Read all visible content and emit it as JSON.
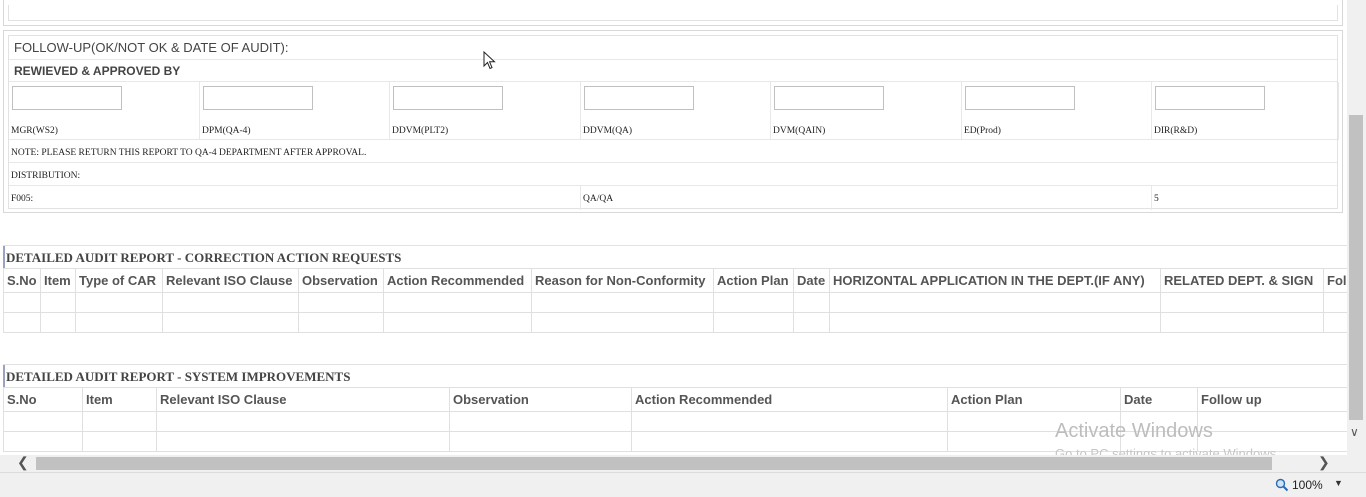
{
  "followup": {
    "title": "FOLLOW-UP(OK/NOT OK & DATE OF AUDIT):",
    "reviewed_title": "REWIEVED & APPROVED BY",
    "signatures": [
      "MGR(WS2)",
      "DPM(QA-4)",
      "DDVM(PLT2)",
      "DDVM(QA)",
      "DVM(QAIN)",
      "ED(Prod)",
      "DIR(R&D)"
    ],
    "note": "NOTE: PLEASE RETURN THIS REPORT TO QA-4 DEPARTMENT AFTER APPROVAL.",
    "distribution": "DISTRIBUTION:",
    "footer": {
      "form_no": "F005:",
      "dept": "QA/QA",
      "count": "5"
    }
  },
  "car_section": {
    "title": "DETAILED AUDIT REPORT - CORRECTION ACTION REQUESTS",
    "columns": [
      "S.No",
      "Item",
      "Type of CAR",
      "Relevant ISO Clause",
      "Observation",
      "Action Recommended",
      "Reason for Non-Conformity",
      "Action Plan",
      "Date",
      "HORIZONTAL APPLICATION IN THE DEPT.(IF ANY)",
      "RELATED DEPT. & SIGN",
      "Follow up"
    ]
  },
  "si_section": {
    "title": "DETAILED AUDIT REPORT - SYSTEM IMPROVEMENTS",
    "columns": [
      "S.No",
      "Item",
      "Relevant ISO Clause",
      "Observation",
      "Action Recommended",
      "Action Plan",
      "Date",
      "Follow up"
    ]
  },
  "watermark": {
    "line1": "Activate Windows",
    "line2": "Go to PC settings to activate Windows."
  },
  "statusbar": {
    "zoom": "100%"
  }
}
